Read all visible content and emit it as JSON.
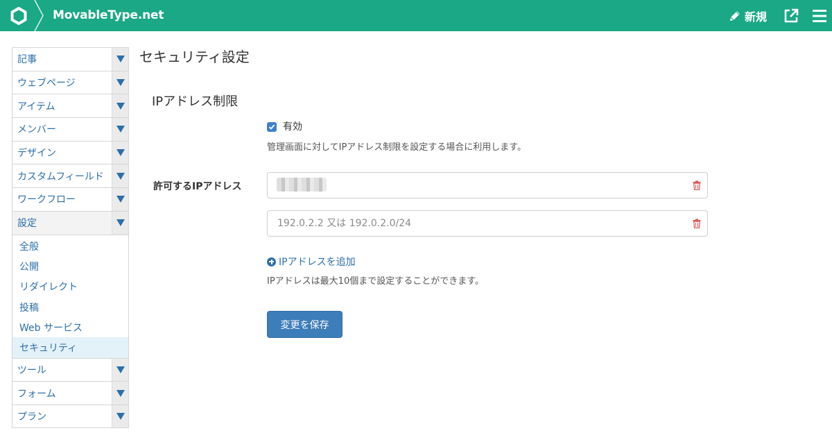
{
  "header": {
    "brand": "MovableType.net",
    "new_label": "新規",
    "color": "#1aa886"
  },
  "sidebar": {
    "items_top": [
      {
        "label": "記事"
      },
      {
        "label": "ウェブページ"
      },
      {
        "label": "アイテム"
      },
      {
        "label": "メンバー"
      },
      {
        "label": "デザイン"
      },
      {
        "label": "カスタムフィールド"
      },
      {
        "label": "ワークフロー"
      },
      {
        "label": "設定"
      }
    ],
    "sub_items": [
      {
        "label": "全般"
      },
      {
        "label": "公開"
      },
      {
        "label": "リダイレクト"
      },
      {
        "label": "投稿"
      },
      {
        "label": "Web サービス"
      },
      {
        "label": "セキュリティ"
      }
    ],
    "items_bottom": [
      {
        "label": "ツール"
      },
      {
        "label": "フォーム"
      },
      {
        "label": "プラン"
      }
    ],
    "icons": [
      "chevron-down-icon"
    ]
  },
  "main": {
    "page_title": "セキュリティ設定",
    "section_title": "IPアドレス制限",
    "enable_label": "有効",
    "enable_checked": true,
    "enable_hint": "管理画面に対してIPアドレス制限を設定する場合に利用します。",
    "allowed_label": "許可するIPアドレス",
    "ip_inputs": [
      {
        "value": "",
        "placeholder": ""
      },
      {
        "value": "",
        "placeholder": "192.0.2.2 又は 192.0.2.0/24"
      }
    ],
    "add_label": "IPアドレスを追加",
    "limit_hint": "IPアドレスは最大10個まで設定することができます。",
    "save_label": "変更を保存",
    "accent": "#3d7dba",
    "danger": "#d9534f"
  }
}
